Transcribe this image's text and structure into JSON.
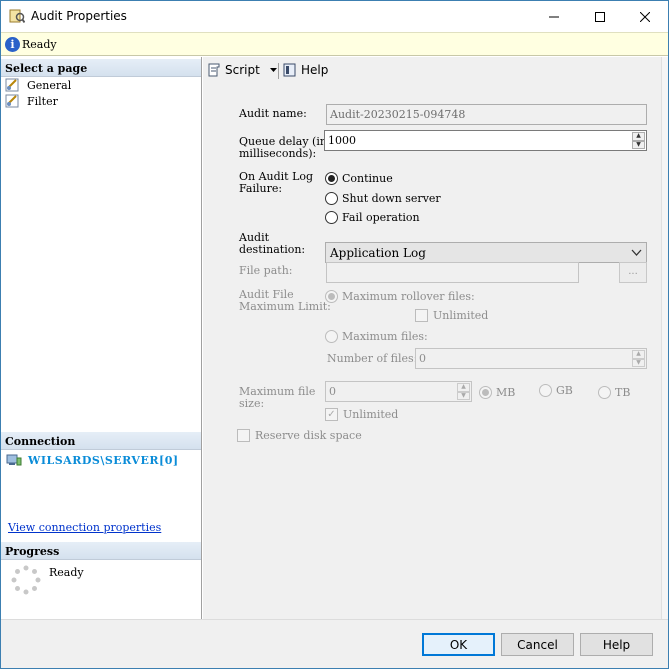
{
  "window": {
    "title": "Audit Properties"
  },
  "status": {
    "text": "Ready"
  },
  "left": {
    "select_page_header": "Select a page",
    "pages": [
      {
        "label": "General"
      },
      {
        "label": "Filter"
      }
    ],
    "connection_header": "Connection",
    "connection_name": "WILSARDS\\SERVER[0]",
    "connection_link": "View connection properties",
    "progress_header": "Progress",
    "progress_text": "Ready"
  },
  "toolbar": {
    "script_label": "Script",
    "help_label": "Help"
  },
  "form": {
    "audit_name_label": "Audit name:",
    "audit_name_value": "Audit-20230215-094748",
    "queue_delay_label_1": "Queue delay (in",
    "queue_delay_label_2": "milliseconds):",
    "queue_delay_value": "1000",
    "failure_label_1": "On Audit Log",
    "failure_label_2": "Failure:",
    "failure_options": [
      {
        "label": "Continue",
        "selected": true
      },
      {
        "label": "Shut down server",
        "selected": false
      },
      {
        "label": "Fail operation",
        "selected": false
      }
    ],
    "destination_label_1": "Audit",
    "destination_label_2": "destination:",
    "destination_value": "Application Log",
    "file_path_label": "File path:",
    "file_path_value": "",
    "browse_label": "...",
    "max_limit_label_1": "Audit File",
    "max_limit_label_2": "Maximum Limit:",
    "max_rollover_label": "Maximum rollover files:",
    "unlimited_label_1": "Unlimited",
    "max_files_label": "Maximum files:",
    "num_files_label": "Number of files:",
    "num_files_value": "0",
    "max_size_label_1": "Maximum file",
    "max_size_label_2": "size:",
    "max_size_value": "0",
    "units": [
      "MB",
      "GB",
      "TB"
    ],
    "unlimited_label_2": "Unlimited",
    "reserve_label": "Reserve disk space"
  },
  "footer": {
    "ok": "OK",
    "cancel": "Cancel",
    "help": "Help"
  }
}
